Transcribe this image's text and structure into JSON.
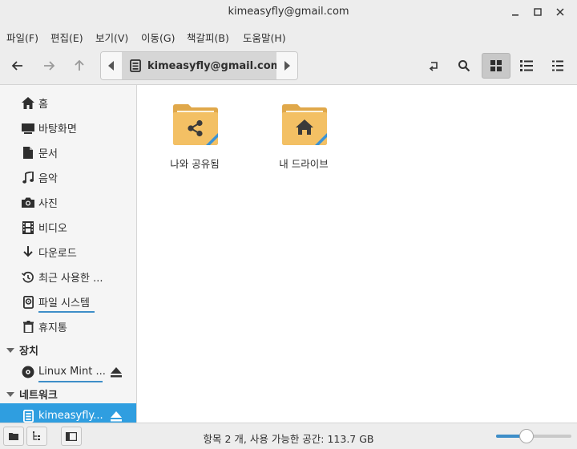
{
  "window": {
    "title": "kimeasyfly@gmail.com"
  },
  "menu": [
    "파일(F)",
    "편집(E)",
    "보기(V)",
    "이동(G)",
    "책갈피(B)",
    "도움말(H)"
  ],
  "toolbar": {
    "path_label": "kimeasyfly@gmail.com",
    "active_view": "icon-view"
  },
  "sidebar": {
    "places": [
      {
        "label": "홈",
        "icon": "home-icon"
      },
      {
        "label": "바탕화면",
        "icon": "desktop-icon"
      },
      {
        "label": "문서",
        "icon": "document-icon"
      },
      {
        "label": "음악",
        "icon": "music-icon"
      },
      {
        "label": "사진",
        "icon": "camera-icon"
      },
      {
        "label": "비디오",
        "icon": "film-icon"
      },
      {
        "label": "다운로드",
        "icon": "download-icon"
      },
      {
        "label": "최근 사용한 ...",
        "icon": "recent-icon"
      },
      {
        "label": "파일 시스템",
        "icon": "drive-icon"
      },
      {
        "label": "휴지통",
        "icon": "trash-icon"
      }
    ],
    "devices_header": "장치",
    "devices": [
      {
        "label": "Linux Mint ...",
        "icon": "disc-icon"
      }
    ],
    "network_header": "네트워크",
    "network": [
      {
        "label": "kimeasyfly...",
        "icon": "network-drive-icon",
        "selected": true
      }
    ]
  },
  "files": [
    {
      "name": "나와 공유됨",
      "emblem": "share-icon"
    },
    {
      "name": "내 드라이브",
      "emblem": "home-icon"
    }
  ],
  "status": {
    "text": "항목 2 개, 사용 가능한 공간: 113.7 GB",
    "zoom_fraction": 0.4
  },
  "colors": {
    "accent": "#2f9ee0",
    "folder": "#f3c064",
    "folder_dark": "#e0a84a",
    "emblem": "#3a3a3a"
  }
}
